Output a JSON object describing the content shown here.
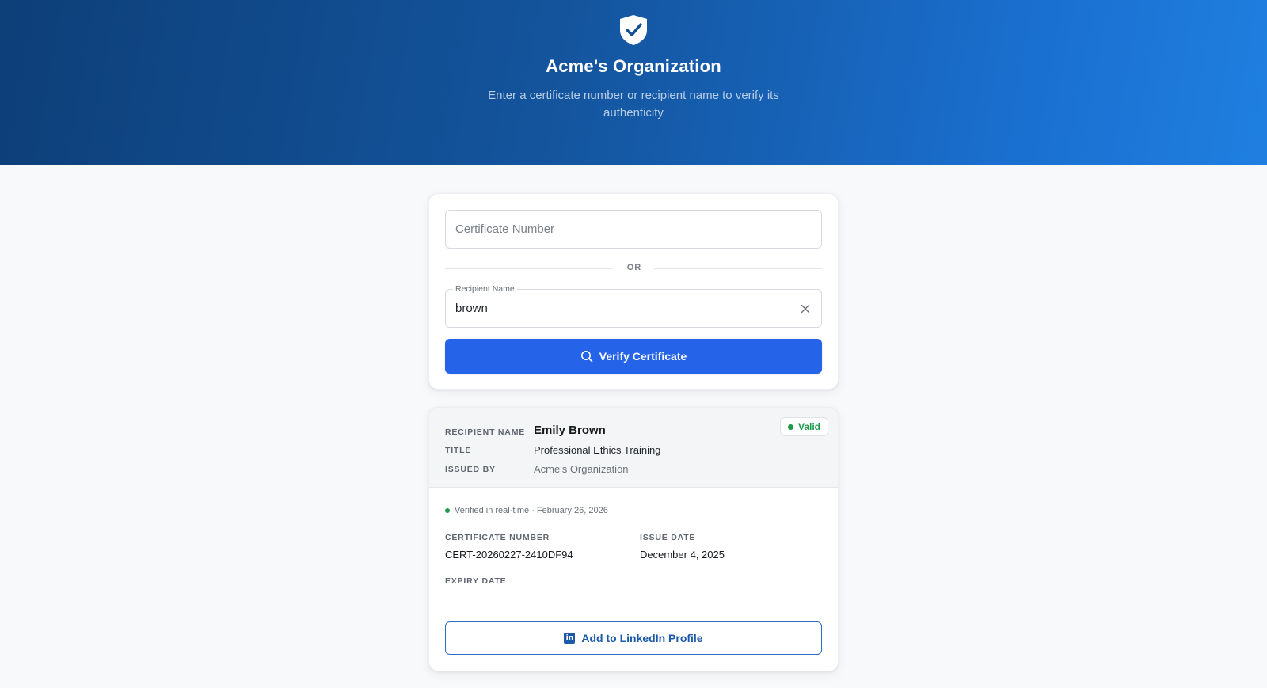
{
  "header": {
    "icon": "shield-check-icon",
    "title": "Acme's Organization",
    "subtitle": "Enter a certificate number or recipient name to verify its authenticity"
  },
  "search": {
    "certificate_placeholder": "Certificate Number",
    "divider_text": "OR",
    "recipient_label": "Recipient Name",
    "recipient_value": "brown",
    "clear_icon": "close-icon",
    "verify_button_label": "Verify Certificate",
    "verify_icon": "search-icon"
  },
  "result": {
    "recipient_label": "RECIPIENT NAME",
    "recipient_value": "Emily Brown",
    "title_label": "TITLE",
    "title_value": "Professional Ethics Training",
    "issued_by_label": "ISSUED BY",
    "issued_by_value": "Acme's Organization",
    "status": "Valid",
    "status_color": "#1d9a4a",
    "verified_text": "Verified in real-time · February 26, 2026",
    "certificate_number_label": "CERTIFICATE NUMBER",
    "certificate_number_value": "CERT-20260227-2410DF94",
    "issue_date_label": "ISSUE DATE",
    "issue_date_value": "December 4, 2025",
    "expiry_date_label": "EXPIRY DATE",
    "expiry_date_value": "-",
    "linkedin_button_label": "Add to LinkedIn Profile",
    "linkedin_icon": "linkedin-icon"
  },
  "colors": {
    "primary": "#2563e8",
    "header_gradient_start": "#0d3f78",
    "header_gradient_end": "#1f7fe0",
    "linkedin": "#1a5aa8"
  }
}
